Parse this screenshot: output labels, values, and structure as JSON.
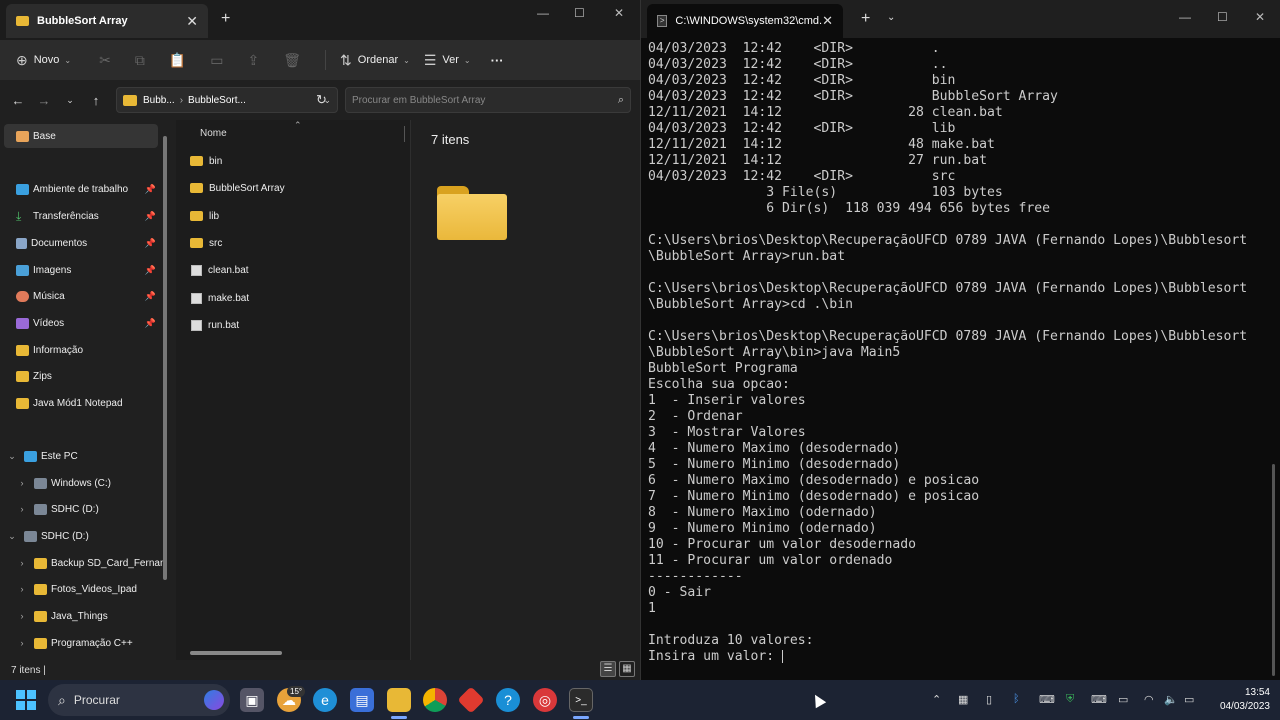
{
  "explorer": {
    "tab_title": "BubbleSort Array",
    "toolbar": {
      "new_label": "Novo",
      "sort_label": "Ordenar",
      "view_label": "Ver",
      "more_label": "···"
    },
    "address": {
      "crumb_root": "Bubb...",
      "crumb_current": "BubbleSort..."
    },
    "search_placeholder": "Procurar em BubbleSort Array",
    "sidebar": {
      "items": [
        {
          "label": "Base",
          "active": true
        },
        {
          "label": "Ambiente de trabalho",
          "pinned": true
        },
        {
          "label": "Transferências",
          "pinned": true
        },
        {
          "label": "Documentos",
          "pinned": true
        },
        {
          "label": "Imagens",
          "pinned": true
        },
        {
          "label": "Música",
          "pinned": true
        },
        {
          "label": "Vídeos",
          "pinned": true
        },
        {
          "label": "Informação"
        },
        {
          "label": "Zips"
        },
        {
          "label": "Java Mód1 Notepad"
        },
        {
          "label": "Este PC"
        },
        {
          "label": "Windows (C:)"
        },
        {
          "label": "SDHC (D:)"
        },
        {
          "label": "SDHC (D:)"
        },
        {
          "label": "Backup SD_Card_Fernan"
        },
        {
          "label": "Fotos_Videos_Ipad"
        },
        {
          "label": "Java_Things"
        },
        {
          "label": "Programação C++"
        }
      ]
    },
    "files": {
      "column_name": "Nome",
      "rows": [
        {
          "name": "bin",
          "type": "folder"
        },
        {
          "name": "BubbleSort Array",
          "type": "folder"
        },
        {
          "name": "lib",
          "type": "folder"
        },
        {
          "name": "src",
          "type": "folder"
        },
        {
          "name": "clean.bat",
          "type": "bat"
        },
        {
          "name": "make.bat",
          "type": "bat"
        },
        {
          "name": "run.bat",
          "type": "bat"
        }
      ]
    },
    "preview_count": "7 itens",
    "status_text": "7 itens  |"
  },
  "terminal": {
    "tab_title": "C:\\WINDOWS\\system32\\cmd.",
    "lines": [
      "04/03/2023  12:42    <DIR>          .",
      "04/03/2023  12:42    <DIR>          ..",
      "04/03/2023  12:42    <DIR>          bin",
      "04/03/2023  12:42    <DIR>          BubbleSort Array",
      "12/11/2021  14:12                28 clean.bat",
      "04/03/2023  12:42    <DIR>          lib",
      "12/11/2021  14:12                48 make.bat",
      "12/11/2021  14:12                27 run.bat",
      "04/03/2023  12:42    <DIR>          src",
      "               3 File(s)            103 bytes",
      "               6 Dir(s)  118 039 494 656 bytes free",
      "",
      "C:\\Users\\brios\\Desktop\\RecuperaçãoUFCD 0789 JAVA (Fernando Lopes)\\Bubblesort",
      "\\BubbleSort Array>run.bat",
      "",
      "C:\\Users\\brios\\Desktop\\RecuperaçãoUFCD 0789 JAVA (Fernando Lopes)\\Bubblesort",
      "\\BubbleSort Array>cd .\\bin",
      "",
      "C:\\Users\\brios\\Desktop\\RecuperaçãoUFCD 0789 JAVA (Fernando Lopes)\\Bubblesort",
      "\\BubbleSort Array\\bin>java Main5",
      "BubbleSort Programa",
      "Escolha sua opcao:",
      "1  - Inserir valores",
      "2  - Ordenar",
      "3  - Mostrar Valores",
      "4  - Numero Maximo (desodernado)",
      "5  - Numero Minimo (desodernado)",
      "6  - Numero Maximo (desodernado) e posicao",
      "7  - Numero Minimo (desodernado) e posicao",
      "8  - Numero Maximo (odernado)",
      "9  - Numero Minimo (odernado)",
      "10 - Procurar um valor desodernado",
      "11 - Procurar um valor ordenado",
      "------------",
      "0 - Sair",
      "1",
      "",
      "Introduza 10 valores:",
      "Insira um valor: "
    ]
  },
  "taskbar": {
    "search_label": "Procurar",
    "weather_temp": "15°",
    "time": "13:54",
    "date": "04/03/2023"
  },
  "colors": {
    "folder": "#e8b836",
    "accent": "#4cc2ff",
    "terminal_text": "#cccccc"
  }
}
